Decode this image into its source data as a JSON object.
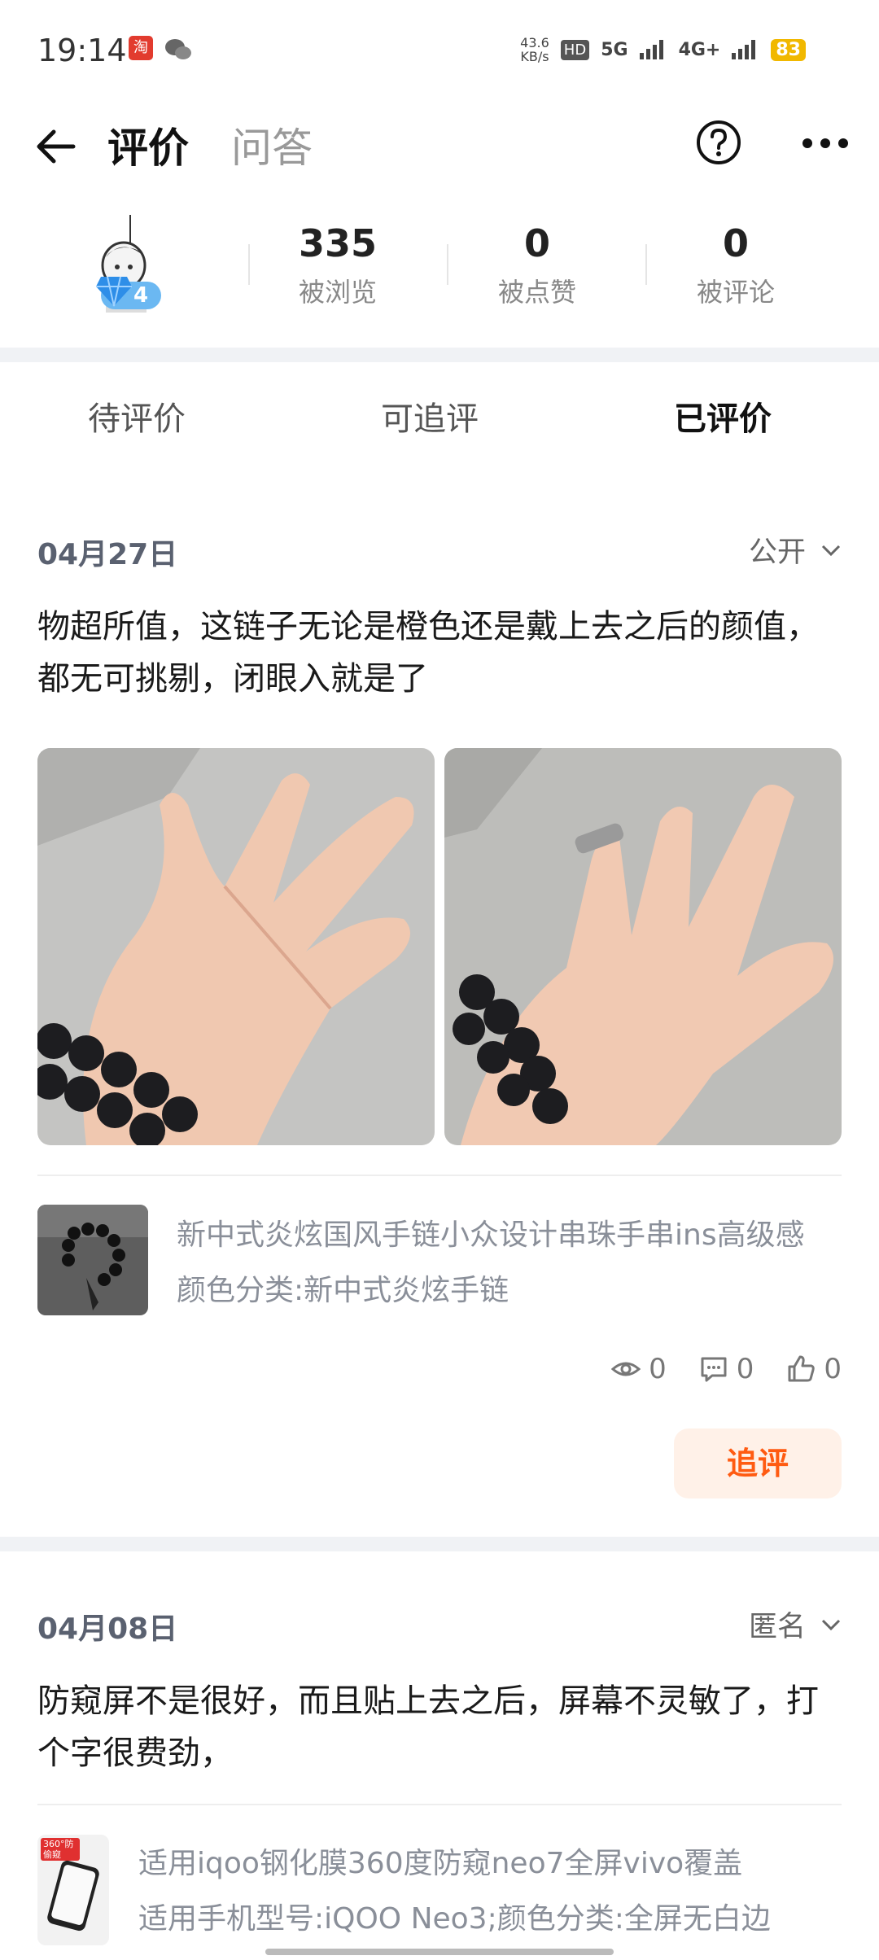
{
  "status_bar": {
    "time": "19:14",
    "net_speed_value": "43.6",
    "net_speed_unit": "KB/s",
    "hd": "HD",
    "signal_5g": "5G",
    "signal_4g": "4G+",
    "battery": "83"
  },
  "header": {
    "tab_reviews": "评价",
    "tab_qa": "问答"
  },
  "profile": {
    "level": "4",
    "stats": [
      {
        "value": "335",
        "label": "被浏览"
      },
      {
        "value": "0",
        "label": "被点赞"
      },
      {
        "value": "0",
        "label": "被评论"
      }
    ]
  },
  "tabs": [
    {
      "label": "待评价"
    },
    {
      "label": "可追评"
    },
    {
      "label": "已评价"
    }
  ],
  "reviews": [
    {
      "date": "04月27日",
      "visibility": "公开",
      "text": "物超所值，这链子无论是橙色还是戴上去之后的颜值，都无可挑剔，闭眼入就是了",
      "product_title": "新中式炎炫国风手链小众设计串珠手串ins高级感",
      "product_variant": "颜色分类:新中式炎炫手链",
      "views": "0",
      "comments": "0",
      "likes": "0",
      "followup_label": "追评"
    },
    {
      "date": "04月08日",
      "visibility": "匿名",
      "text": "防窥屏不是很好，而且贴上去之后，屏幕不灵敏了，打个字很费劲，",
      "product_title": "适用iqoo钢化膜360度防窥neo7全屏vivo覆盖",
      "product_variant": "适用手机型号:iQOO Neo3;颜色分类:全屏无白边",
      "thumb_badge": "360°防偷窥"
    }
  ],
  "colors": {
    "accent": "#ff5b12",
    "followup_bg": "#fff1e8",
    "separator": "#f0f2f5",
    "battery": "#f1b800"
  }
}
